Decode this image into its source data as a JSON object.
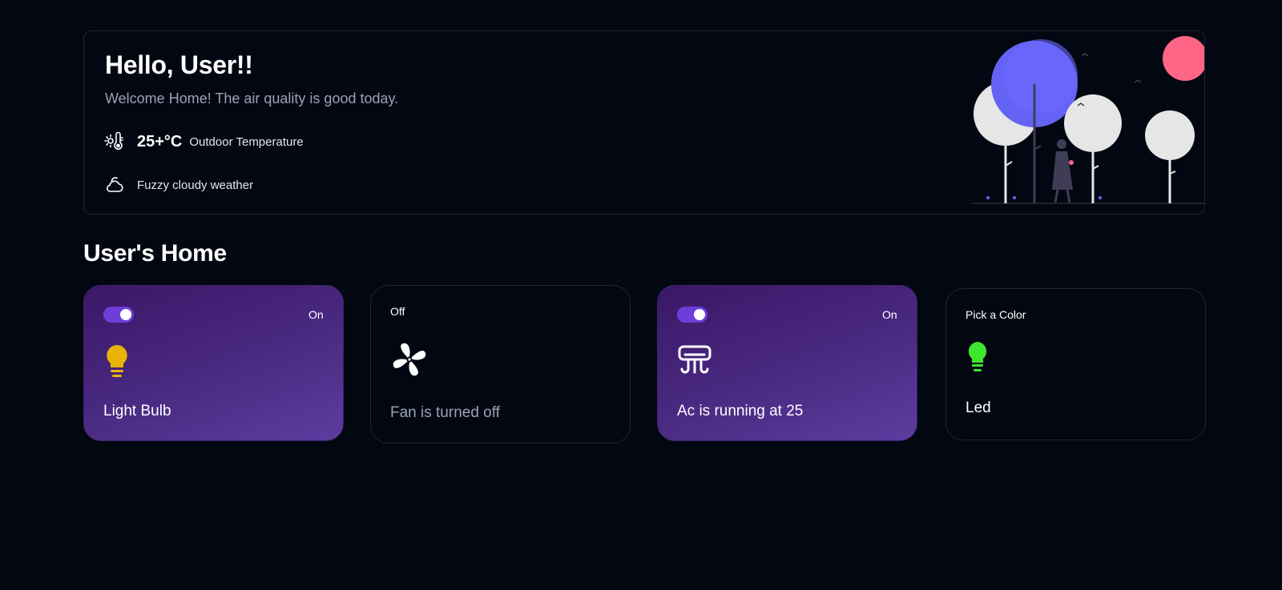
{
  "welcome": {
    "greeting": "Hello, User!!",
    "subtitle": "Welcome Home! The air quality is good today.",
    "temperature": {
      "value": "25+°C",
      "label": "Outdoor Temperature",
      "icon": "thermometer-sun-icon"
    },
    "weather": {
      "label": "Fuzzy cloudy weather",
      "icon": "cloud-icon"
    }
  },
  "section": {
    "title": "User's Home"
  },
  "devices": [
    {
      "state": "On",
      "toggle_on": true,
      "icon": "light-bulb-icon",
      "icon_color": "#eab308",
      "name": "Light Bulb"
    },
    {
      "state": "Off",
      "toggle_on": false,
      "icon": "fan-icon",
      "icon_color": "#ffffff",
      "name": "Fan is turned off"
    },
    {
      "state": "On",
      "toggle_on": true,
      "icon": "air-conditioner-icon",
      "icon_color": "#ffffff",
      "name": "Ac is running at 25"
    },
    {
      "state": "Pick a Color",
      "icon": "led-bulb-icon",
      "icon_color": "#3ee62e",
      "name": "Led"
    }
  ],
  "colors": {
    "background": "#030712",
    "accent": "#6d3fd8",
    "card_on_gradient_start": "#3a1766",
    "card_on_gradient_end": "#5e3ca0"
  }
}
